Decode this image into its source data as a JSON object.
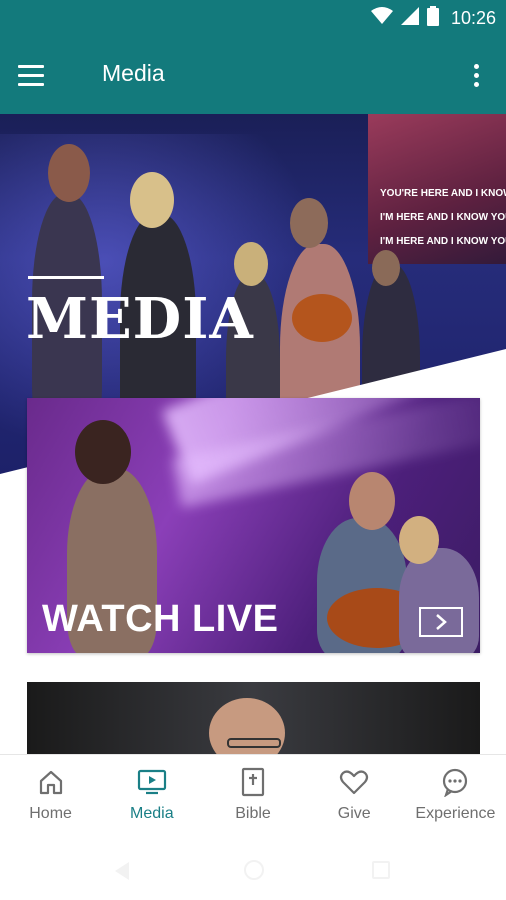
{
  "status_bar": {
    "time": "10:26",
    "icons": [
      "wifi-icon",
      "signal-icon",
      "battery-icon"
    ]
  },
  "app_bar": {
    "title": "Media",
    "menu_icon": "hamburger-menu-icon",
    "overflow_icon": "more-vert-icon"
  },
  "hero": {
    "title": "MEDIA",
    "screen_lyrics": [
      "YOU'RE HERE AND I KNOW YOU ARE MOVING",
      "I'M HERE AND I KNOW YOU ARE MOVING",
      "I'M HERE AND I KNOW YOU ARE..."
    ]
  },
  "cards": [
    {
      "title": "WATCH LIVE",
      "arrow_icon": "chevron-right-icon"
    },
    {
      "title": ""
    }
  ],
  "bottom_nav": {
    "items": [
      {
        "label": "Home",
        "icon": "home-icon",
        "active": false
      },
      {
        "label": "Media",
        "icon": "tv-play-icon",
        "active": true
      },
      {
        "label": "Bible",
        "icon": "bible-icon",
        "active": false
      },
      {
        "label": "Give",
        "icon": "heart-icon",
        "active": false
      },
      {
        "label": "Experience",
        "icon": "chat-bubble-icon",
        "active": false
      }
    ]
  },
  "colors": {
    "primary": "#137a7c",
    "nav_active": "#1a7f86",
    "nav_inactive": "#6f6f6f"
  }
}
